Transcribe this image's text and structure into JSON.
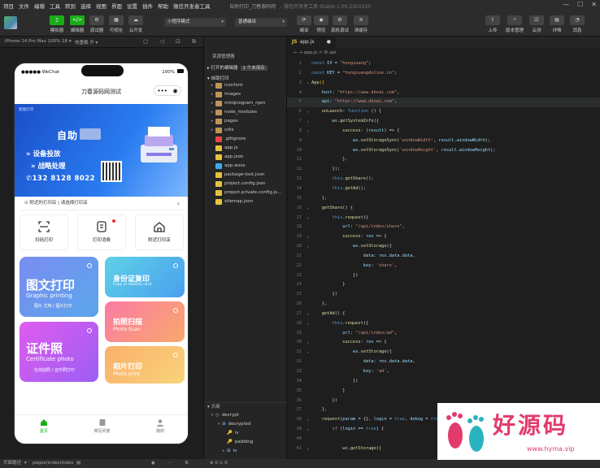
{
  "menubar": {
    "items": [
      "项目",
      "文件",
      "编辑",
      "工具",
      "转到",
      "选择",
      "视图",
      "界面",
      "设置",
      "插件",
      "帮助",
      "微信开发者工具"
    ],
    "window_title": "自助打印_刀春源码网",
    "window_subtitle": "- 微信开发者工具 Stable 1.06.2303220"
  },
  "toolbar": {
    "left_buttons": [
      {
        "icon": "phone-icon",
        "label": "模拟器"
      },
      {
        "icon": "code-icon",
        "label": "编辑器"
      },
      {
        "icon": "debug-icon",
        "label": "调试器"
      },
      {
        "icon": "visual-icon",
        "label": "可视化"
      },
      {
        "icon": "cloud-icon",
        "label": "云开发"
      }
    ],
    "mode_select": "小程序模式",
    "compile_select": "普通编译",
    "mid_buttons": [
      "编译",
      "预览",
      "真机调试",
      "清缓存"
    ],
    "right_buttons": [
      "上传",
      "版本管理",
      "云测",
      "详情",
      "消息"
    ]
  },
  "subbar": {
    "device": "iPhone 14 Pro Max 100% 16 ▾",
    "hotreload": "热重载 开 ▾"
  },
  "phone": {
    "carrier": "●●●●● WeChat",
    "battery": "100%",
    "page_title": "刀春源码网测试",
    "banner": {
      "small": "智能打印",
      "big": "自助",
      "line1": "» 设备投放",
      "line2": "» 战略处理",
      "tel": "132 8128 8022"
    },
    "address": "附近的打印店 | 请选择打印店",
    "quick": [
      "扫码打印",
      "打印消费",
      "附近打印店"
    ],
    "cards": [
      {
        "title": "图文打印",
        "en": "Graphic printing",
        "sub": "图片 文档 / 图片打印"
      },
      {
        "title": "身份证复印",
        "en": "Copy of identity card"
      },
      {
        "title": "拍照扫描",
        "en": "Photo Scan"
      },
      {
        "title": "证件照",
        "en": "Certificate photo",
        "sub": "在线拍照 / 证件照打印"
      },
      {
        "title": "相片打印",
        "en": "Photo print"
      }
    ],
    "tabs": [
      "首页",
      "常见问答",
      "我的"
    ]
  },
  "explorer": {
    "header": "资源管理器",
    "project_label": "打开的编辑器",
    "project_badge": "1 个未保存",
    "section": "自助打印",
    "tree": [
      {
        "name": "iconfont",
        "type": "folder"
      },
      {
        "name": "images",
        "type": "folder"
      },
      {
        "name": "miniprogram_npm",
        "type": "folder"
      },
      {
        "name": "node_modules",
        "type": "folder"
      },
      {
        "name": "pages",
        "type": "folder"
      },
      {
        "name": "utils",
        "type": "folder"
      },
      {
        "name": ".gitignore",
        "type": "git"
      },
      {
        "name": "app.js",
        "type": "js"
      },
      {
        "name": "app.json",
        "type": "json"
      },
      {
        "name": "app.wxss",
        "type": "wxss"
      },
      {
        "name": "package-lock.json",
        "type": "json"
      },
      {
        "name": "project.config.json",
        "type": "json"
      },
      {
        "name": "project.private.config.js...",
        "type": "json"
      },
      {
        "name": "sitemap.json",
        "type": "json"
      }
    ],
    "outline_header": "大纲",
    "outline": [
      "decrypt",
      "decrypted",
      "iv",
      "padding",
      "iv"
    ]
  },
  "editor": {
    "tab": "app.js",
    "breadcrumb": "app.js > ⚙ api"
  },
  "statusbar": {
    "path_label": "页面路径",
    "path": "pages/index/index",
    "problems": "⊗ 0 ⚠ 0"
  },
  "watermark": {
    "text": "好源码",
    "url": "www.hyma.vip"
  },
  "colors": {
    "accent_green": "#1aad19",
    "editor_bg": "#1e1e1e",
    "banner_blue": "#2a7cf0"
  }
}
